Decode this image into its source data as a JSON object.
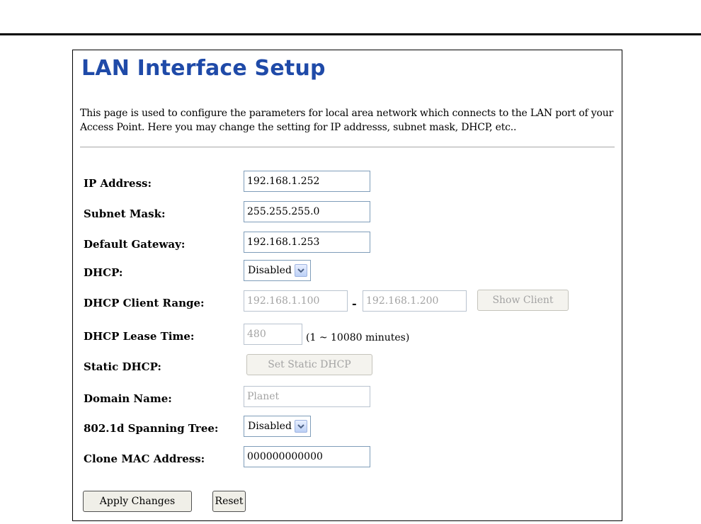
{
  "page": {
    "title": "LAN Interface Setup",
    "description": "This page is used to configure the parameters for local area network which connects to the LAN port of your Access Point. Here you may change the setting for IP addresss, subnet mask, DHCP, etc.."
  },
  "form": {
    "ip_address": {
      "label": "IP Address:",
      "value": "192.168.1.252"
    },
    "subnet_mask": {
      "label": "Subnet Mask:",
      "value": "255.255.255.0"
    },
    "default_gateway": {
      "label": "Default Gateway:",
      "value": "192.168.1.253"
    },
    "dhcp": {
      "label": "DHCP:",
      "selected": "Disabled"
    },
    "dhcp_client_range": {
      "label": "DHCP Client Range:",
      "start": "192.168.1.100",
      "separator": "-",
      "end": "192.168.1.200",
      "show_client_label": "Show Client"
    },
    "dhcp_lease_time": {
      "label": "DHCP Lease Time:",
      "value": "480",
      "hint": "(1 ~ 10080 minutes)"
    },
    "static_dhcp": {
      "label": "Static DHCP:",
      "button_label": "Set Static DHCP"
    },
    "domain_name": {
      "label": "Domain Name:",
      "value": "Planet"
    },
    "spanning_tree": {
      "label": "802.1d Spanning Tree:",
      "selected": "Disabled"
    },
    "clone_mac": {
      "label": "Clone MAC Address:",
      "value": "000000000000"
    }
  },
  "actions": {
    "apply_label": "Apply Changes",
    "reset_label": "Reset"
  },
  "colors": {
    "title": "#1f4aa8",
    "input_border": "#7f9db9",
    "disabled_text": "#a3a3a3"
  },
  "icons": {
    "dropdown": "chevron-down-icon"
  }
}
